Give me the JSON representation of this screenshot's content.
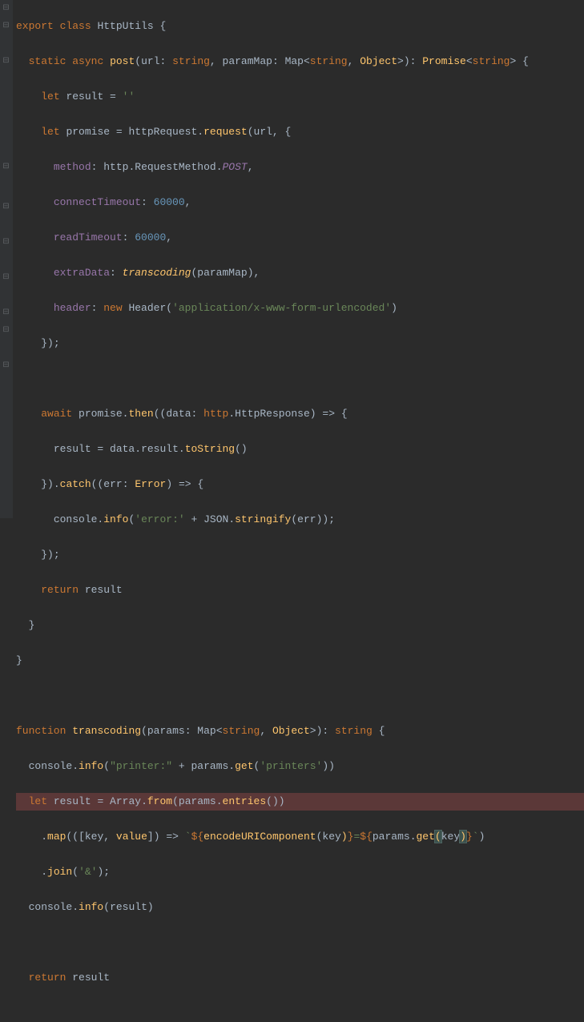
{
  "code": {
    "l1": {
      "export": "export",
      "class": "class",
      "name": "HttpUtils",
      "ob": "{"
    },
    "l2": {
      "static": "static",
      "async": "async",
      "fn": "post",
      "op": "(",
      "p1": "url",
      "c1": ": ",
      "t1": "string",
      "cm1": ", ",
      "p2": "paramMap",
      "c2": ": ",
      "t2": "Map",
      "lt": "<",
      "t3": "string",
      "cm2": ", ",
      "t4": "Object",
      "gt": ">",
      "cp": ")",
      "c3": ": ",
      "ret": "Promise",
      "lt2": "<",
      "t5": "string",
      "gt2": ">",
      "ob": " {"
    },
    "l3": {
      "let": "let",
      "var": "result",
      "eq": " = ",
      "val": "''"
    },
    "l4": {
      "let": "let",
      "var": "promise",
      "eq": " = ",
      "o": "httpRequest",
      "dot": ".",
      "m": "request",
      "op": "(",
      "a1": "url",
      "cm": ", ",
      "ob": "{"
    },
    "l5": {
      "k": "method",
      "c": ": ",
      "o": "http",
      "d": ".",
      "p1": "RequestMethod",
      "d2": ".",
      "p2": "POST",
      "cm": ","
    },
    "l6": {
      "k": "connectTimeout",
      "c": ": ",
      "v": "60000",
      "cm": ","
    },
    "l7": {
      "k": "readTimeout",
      "c": ": ",
      "v": "60000",
      "cm": ","
    },
    "l8": {
      "k": "extraData",
      "c": ": ",
      "f": "transcoding",
      "op": "(",
      "a": "paramMap",
      "cp": ")",
      "cm": ","
    },
    "l9": {
      "k": "header",
      "c": ": ",
      "new": "new",
      "cls": "Header",
      "op": "(",
      "s": "'application/x-www-form-urlencoded'",
      "cp": ")"
    },
    "l10": {
      "cb": "}",
      "cp": ")",
      "sc": ";"
    },
    "l12": {
      "await": "await",
      "o": "promise",
      "d": ".",
      "m": "then",
      "op": "(",
      "op2": "(",
      "a": "data",
      "c": ": ",
      "t1": "http",
      "d2": ".",
      "t2": "HttpResponse",
      "cp": ")",
      "ar": " => ",
      "ob": "{"
    },
    "l13": {
      "v": "result",
      "eq": " = ",
      "o": "data",
      "d": ".",
      "p": "result",
      "d2": ".",
      "m": "toString",
      "op": "(",
      ")": ")"
    },
    "l14": {
      "cb": "}",
      "cp": ")",
      "d": ".",
      "m": "catch",
      "op": "(",
      "op2": "(",
      "a": "err",
      "c": ": ",
      "t": "Error",
      "cp2": ")",
      "ar": " => ",
      "ob": "{"
    },
    "l15": {
      "o": "console",
      "d": ".",
      "m": "info",
      "op": "(",
      "s": "'error:'",
      "pl": " + ",
      "o2": "JSON",
      "d2": ".",
      "m2": "stringify",
      "op2": "(",
      "a": "err",
      "cp2": ")",
      "cp": ")",
      "sc": ";"
    },
    "l16": {
      "cb": "}",
      "cp": ")",
      "sc": ";"
    },
    "l17": {
      "ret": "return",
      "v": " result"
    },
    "l18": {
      "cb": "}"
    },
    "l19": {
      "cb": "}"
    },
    "l21": {
      "fn": "function",
      "name": "transcoding",
      "op": "(",
      "p": "params",
      "c": ": ",
      "t": "Map",
      "lt": "<",
      "t1": "string",
      "cm": ", ",
      "t2": "Object",
      "gt": ">",
      "cp": ")",
      "c2": ": ",
      "rt": "string",
      "ob": " {"
    },
    "l22": {
      "o": "console",
      "d": ".",
      "m": "info",
      "op": "(",
      "s": "\"printer:\"",
      "pl": " + ",
      "o2": "params",
      "d2": ".",
      "m2": "get",
      "op2": "(",
      "s2": "'printers'",
      "cp2": ")",
      "cp": ")"
    },
    "l23": {
      "let": "let",
      "v": "result",
      "eq": " = ",
      "o": "Array",
      "d": ".",
      "m": "from",
      "op": "(",
      "o2": "params",
      "d2": ".",
      "m2": "entries",
      "op2": "(",
      "cp2": ")",
      "cp": ")"
    },
    "l24": {
      "d": ".",
      "m": "map",
      "op": "(",
      "op2": "(",
      "ob": "[",
      "a1": "key",
      "cm": ", ",
      "a2": "value",
      "cb": "]",
      "cp2": ")",
      "ar": " => ",
      "bt": "`",
      "ts1": "${",
      "f": "encodeURIComponent",
      "op3": "(",
      "a3": "key",
      "cp3": ")",
      "te1": "}",
      "eq": "=",
      "ts2": "${",
      "o": "params",
      "d2": ".",
      "m2": "get",
      "op4": "(",
      "a4": "key",
      "cp4": ")",
      "te2": "}",
      "bt2": "`",
      "cp": ")"
    },
    "l25": {
      "d": ".",
      "m": "join",
      "op": "(",
      "s": "'&'",
      "cp": ")",
      "sc": ";"
    },
    "l26": {
      "o": "console",
      "d": ".",
      "m": "info",
      "op": "(",
      "a": "result",
      "cp": ")"
    },
    "l28": {
      "ret": "return",
      "v": " result"
    }
  }
}
